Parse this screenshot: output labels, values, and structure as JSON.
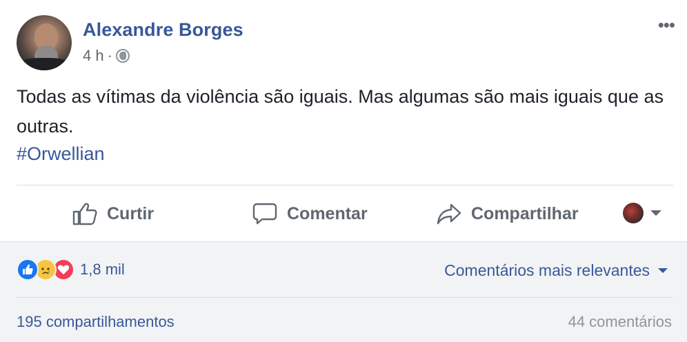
{
  "post": {
    "author": "Alexandre Borges",
    "time": "4 h",
    "time_separator": "·",
    "privacy_icon": "globe-icon",
    "more_label": "•••",
    "text": "Todas as vítimas da violência são iguais. Mas algumas são mais iguais que as outras.",
    "hashtag": "#Orwellian"
  },
  "actions": {
    "like_label": "Curtir",
    "comment_label": "Comentar",
    "share_label": "Compartilhar"
  },
  "reactions": {
    "types": [
      "like",
      "sad",
      "love"
    ],
    "count": "1,8 mil",
    "sort_label": "Comentários mais relevantes"
  },
  "stats": {
    "shares": "195 compartilhamentos",
    "comments": "44 comentários"
  },
  "colors": {
    "link": "#385898",
    "muted": "#616770",
    "like": "#1877f2",
    "sad": "#f7c640",
    "love": "#f33e58",
    "footer_bg": "#f2f3f5"
  }
}
